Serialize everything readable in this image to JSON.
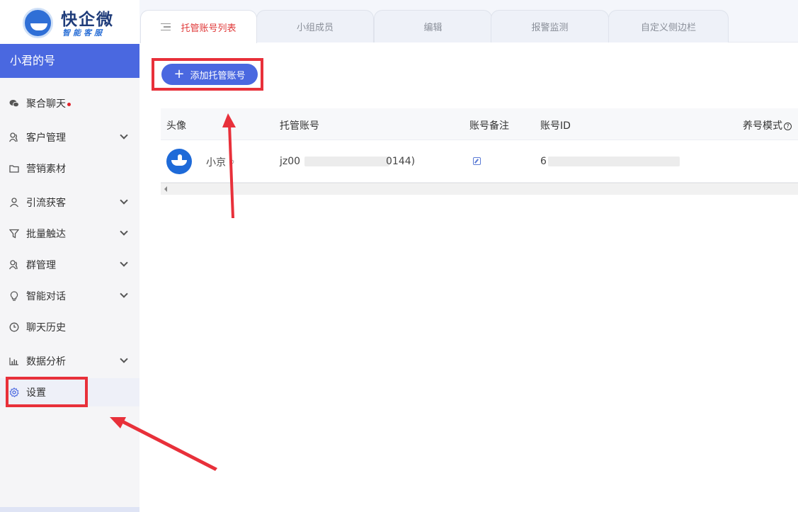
{
  "app": {
    "logo_title": "快企微",
    "logo_subtitle": "智能客服",
    "account_name": "小君的号"
  },
  "sidebar": {
    "items": [
      {
        "label": "聚合聊天",
        "icon": "wechat-icon",
        "has_chevron": false,
        "badge": "red-dot"
      },
      {
        "label": "客户管理",
        "icon": "customers-icon",
        "has_chevron": true
      },
      {
        "label": "营销素材",
        "icon": "folder-icon",
        "has_chevron": false
      },
      {
        "label": "引流获客",
        "icon": "user-icon",
        "has_chevron": true
      },
      {
        "label": "批量触达",
        "icon": "funnel-icon",
        "has_chevron": true
      },
      {
        "label": "群管理",
        "icon": "group-icon",
        "has_chevron": true
      },
      {
        "label": "智能对话",
        "icon": "bulb-icon",
        "has_chevron": true
      },
      {
        "label": "聊天历史",
        "icon": "clock-icon",
        "has_chevron": false
      },
      {
        "label": "数据分析",
        "icon": "chart-icon",
        "has_chevron": true
      },
      {
        "label": "设置",
        "icon": "gear-icon",
        "has_chevron": false,
        "active": true
      }
    ]
  },
  "tabs": [
    {
      "label": "托管账号列表",
      "active": true
    },
    {
      "label": "小组成员"
    },
    {
      "label": "编辑"
    },
    {
      "label": "报警监测"
    },
    {
      "label": "自定义侧边栏"
    }
  ],
  "toolbar": {
    "add_button_label": "添加托管账号"
  },
  "table": {
    "headers": {
      "avatar": "头像",
      "account": "托管账号",
      "remark": "账号备注",
      "account_id": "账号ID",
      "mode": "养号模式"
    },
    "rows": [
      {
        "name": "小京",
        "account": "jz00",
        "account_tail": "0144)",
        "account_id": "6"
      }
    ]
  },
  "colors": {
    "accent": "#4a68e0",
    "highlight": "#e8303a",
    "active_tab_text": "#e03a3a"
  }
}
